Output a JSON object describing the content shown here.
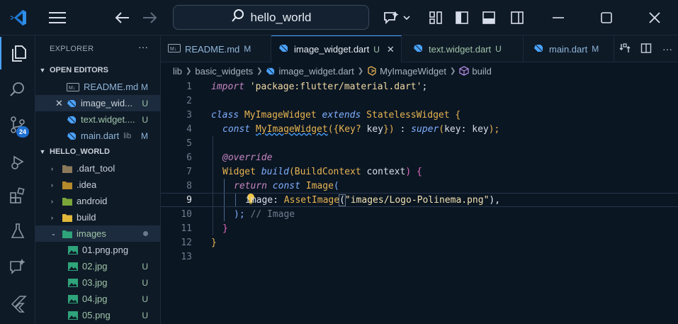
{
  "titlebar": {
    "search": "hello_world",
    "colors": {
      "accent": "#4aa3ff",
      "badge": "#1e6fd1"
    }
  },
  "activity": {
    "items": [
      "explorer-icon",
      "search-icon",
      "source-control-icon",
      "run-debug-icon",
      "extensions-icon",
      "testing-icon",
      "copilot-icon",
      "flutter-icon"
    ],
    "scm_badge": "24"
  },
  "sidebar": {
    "title": "EXPLORER",
    "more": "···",
    "open_editors": {
      "title": "OPEN EDITORS",
      "items": [
        {
          "name": "README.md",
          "status": "M",
          "icon": "markdown-icon"
        },
        {
          "name": "image_wid...",
          "status": "U",
          "icon": "dart-icon"
        },
        {
          "name": "text.widget....",
          "status": "U",
          "icon": "dart-icon"
        },
        {
          "name": "main.dart",
          "sub": "lib",
          "status": "M",
          "icon": "dart-icon"
        }
      ]
    },
    "project": {
      "title": "HELLO_WORLD",
      "items": [
        {
          "name": ".dart_tool",
          "type": "folder"
        },
        {
          "name": ".idea",
          "type": "folder"
        },
        {
          "name": "android",
          "type": "folder"
        },
        {
          "name": "build",
          "type": "folder"
        },
        {
          "name": "images",
          "type": "folder-open"
        },
        {
          "name": "01.png.png",
          "status": ""
        },
        {
          "name": "02.jpg",
          "status": "U"
        },
        {
          "name": "03.jpg",
          "status": "U"
        },
        {
          "name": "04.jpg",
          "status": "U"
        },
        {
          "name": "05.png",
          "status": "U"
        }
      ]
    }
  },
  "tabs": [
    {
      "name": "README.md",
      "status": "M"
    },
    {
      "name": "image_widget.dart",
      "status": "U",
      "close": "✕"
    },
    {
      "name": "text.widget.dart",
      "status": "U"
    },
    {
      "name": "main.dart",
      "status": "M"
    }
  ],
  "breadcrumb": [
    "lib",
    "basic_widgets",
    "image_widget.dart",
    "MyImageWidget",
    "build"
  ],
  "editor": {
    "line_numbers": [
      "1",
      "2",
      "3",
      "4",
      "5",
      "6",
      "7",
      "8",
      "9",
      "10",
      "11",
      "12",
      "13"
    ],
    "current_line": 9,
    "lines": {
      "l1": {
        "a": "import",
        "b": " ",
        "c": "'package:flutter/material.dart'",
        "d": ";"
      },
      "l3": {
        "a": "class",
        "b": " MyImageWidget ",
        "c": "extends",
        "d": " StatelessWidget ",
        "e": "{"
      },
      "l4": {
        "a": "const",
        "b": " ",
        "c": "MyImageWidget",
        "d": "({",
        "e": "Key?",
        "f": " key",
        "g": "})",
        "h": " : ",
        "i": "super",
        "j": "(",
        "k": "key",
        "l": ": key",
        "m": ");"
      },
      "l6": {
        "a": "@override"
      },
      "l7": {
        "a": "Widget",
        "b": " ",
        "c": "build",
        "d": "(",
        "e": "BuildContext",
        "f": " context",
        "g": ") {"
      },
      "l8": {
        "a": "return",
        "b": " ",
        "c": "const",
        "d": " ",
        "e": "Image",
        "f": "("
      },
      "l9": {
        "a": "image",
        "b": ": ",
        "c": "AssetImage",
        "d": "(",
        "e": "\"images/Logo-Polinema.png\"",
        "f": "),"
      },
      "l10": {
        "a": ");",
        "b": " // Image"
      },
      "l11": {
        "a": "}"
      },
      "l12": {
        "a": "}"
      }
    }
  }
}
